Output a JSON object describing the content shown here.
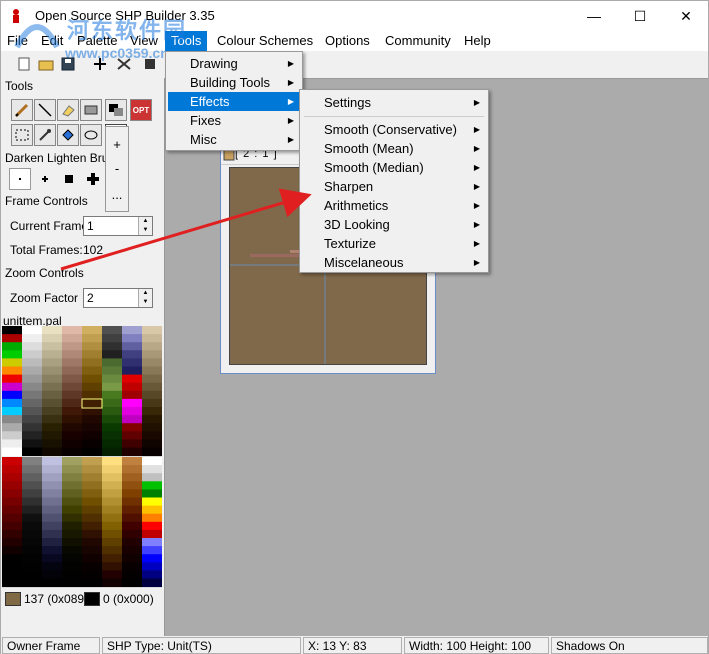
{
  "window": {
    "title": "Open Source SHP Builder 3.35",
    "minimize": "—",
    "maximize": "☐",
    "close": "✕"
  },
  "watermark": {
    "text": "河东软件园",
    "url": "www.pc0359.cn"
  },
  "menubar": {
    "items": [
      "File",
      "Edit",
      "Palette",
      "View",
      "Tools",
      "Colour Schemes",
      "Options",
      "Community",
      "Help"
    ],
    "active": "Tools"
  },
  "tools_menu": {
    "items": [
      "Drawing",
      "Building Tools",
      "Effects",
      "Fixes",
      "Misc"
    ],
    "highlighted": "Effects"
  },
  "effects_menu": {
    "items": [
      "Settings",
      "Smooth (Conservative)",
      "Smooth (Mean)",
      "Smooth (Median)",
      "Sharpen",
      "Arithmetics",
      "3D Looking",
      "Texturize",
      "Miscelaneous"
    ]
  },
  "left_panel": {
    "tools_label": "Tools",
    "darken_label": "Darken Lighten Brush",
    "frame_controls_label": "Frame Controls",
    "current_frame_label": "Current Frame",
    "current_frame_value": "1",
    "total_frames_label": "Total Frames:",
    "total_frames_value": "102",
    "zoom_controls_label": "Zoom Controls",
    "zoom_factor_label": "Zoom Factor",
    "zoom_factor_value": "2",
    "palette_name": "unittem.pal",
    "color1_label": "137 (0x089)",
    "color2_label": "0 (0x000)",
    "color1_hex": "#7f6a45",
    "color2_hex": "#000000"
  },
  "brush_popup": {
    "items": [
      "+",
      "-",
      "..."
    ]
  },
  "tool_labels": {
    "opt": "OPT",
    "plusminus": "+−"
  },
  "frame_window": {
    "title": "[ 2 : 1 ]"
  },
  "statusbar": {
    "owner": "Owner Frame",
    "shp_type": "SHP Type: Unit(TS)",
    "coords": "X: 13 Y: 83",
    "size": "Width: 100 Height: 100",
    "shadows": "Shadows On"
  }
}
